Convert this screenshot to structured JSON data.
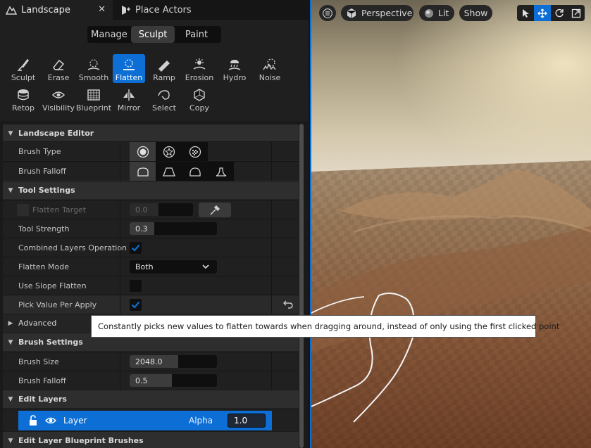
{
  "tabs": [
    {
      "label": "Landscape"
    },
    {
      "label": "Place Actors"
    }
  ],
  "modes": [
    "Manage",
    "Sculpt",
    "Paint"
  ],
  "active_mode": "Sculpt",
  "tools": {
    "row1": [
      "Sculpt",
      "Erase",
      "Smooth",
      "Flatten",
      "Ramp",
      "Erosion",
      "Hydro",
      "Noise"
    ],
    "row2": [
      "Retop",
      "Visibility",
      "Blueprint",
      "Mirror",
      "Select",
      "Copy"
    ],
    "selected": "Flatten"
  },
  "sections": {
    "landscape_editor": "Landscape Editor",
    "tool_settings": "Tool Settings",
    "advanced": "Advanced",
    "brush_settings": "Brush Settings",
    "edit_layers": "Edit Layers",
    "edit_layer_blueprint_brushes": "Edit Layer Blueprint Brushes"
  },
  "props": {
    "brush_type": {
      "label": "Brush Type"
    },
    "brush_falloff_shape": {
      "label": "Brush Falloff"
    },
    "flatten_target": {
      "label": "Flatten Target",
      "value": "0.0",
      "fraction": 0.45
    },
    "tool_strength": {
      "label": "Tool Strength",
      "value": "0.3",
      "fraction": 0.28
    },
    "combined_layers_operation": {
      "label": "Combined Layers Operation",
      "checked": true
    },
    "flatten_mode": {
      "label": "Flatten Mode",
      "value": "Both"
    },
    "use_slope_flatten": {
      "label": "Use Slope Flatten",
      "checked": false
    },
    "pick_value_per_apply": {
      "label": "Pick Value Per Apply",
      "checked": true
    },
    "brush_size": {
      "label": "Brush Size",
      "value": "2048.0",
      "fraction": 0.56
    },
    "brush_falloff": {
      "label": "Brush Falloff",
      "value": "0.5",
      "fraction": 0.48
    }
  },
  "layer": {
    "name": "Layer",
    "alpha_label": "Alpha",
    "alpha_value": "1.0"
  },
  "viewport": {
    "perspective": "Perspective",
    "lit": "Lit",
    "show": "Show"
  },
  "tooltip": "Constantly picks new values to flatten towards when dragging around, instead of only using the first clicked point",
  "colors": {
    "accent": "#0d6fd6"
  }
}
